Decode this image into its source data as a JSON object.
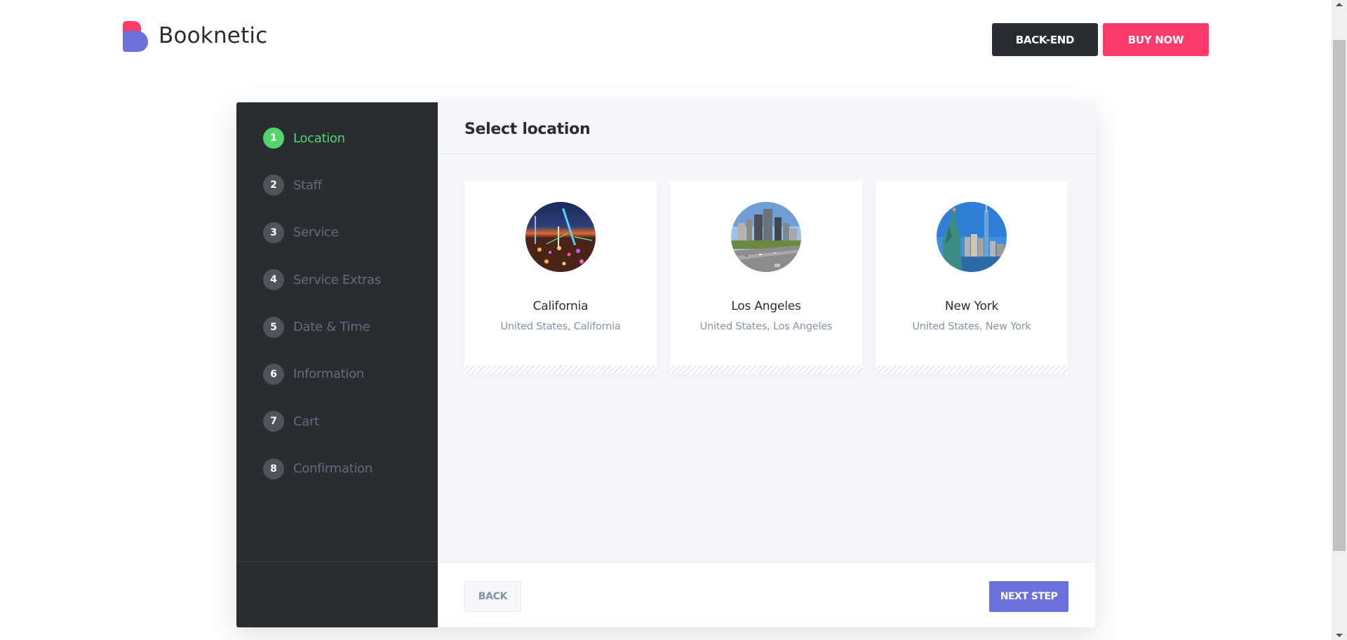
{
  "brand": {
    "name": "Booknetic"
  },
  "topbar": {
    "backend_label": "BACK-END",
    "buynow_label": "BUY NOW"
  },
  "colors": {
    "accent": "#6c70dc",
    "pink": "#fc3a6b",
    "active_step": "#53d56c",
    "sidebar_bg": "#292d32"
  },
  "steps": [
    {
      "num": "1",
      "label": "Location",
      "active": true
    },
    {
      "num": "2",
      "label": "Staff",
      "active": false
    },
    {
      "num": "3",
      "label": "Service",
      "active": false
    },
    {
      "num": "4",
      "label": "Service Extras",
      "active": false
    },
    {
      "num": "5",
      "label": "Date & Time",
      "active": false
    },
    {
      "num": "6",
      "label": "Information",
      "active": false
    },
    {
      "num": "7",
      "label": "Cart",
      "active": false
    },
    {
      "num": "8",
      "label": "Confirmation",
      "active": false
    }
  ],
  "main": {
    "title": "Select location",
    "locations": [
      {
        "name": "California",
        "address": "United States, California",
        "image": "california-night-fair-photo"
      },
      {
        "name": "Los Angeles",
        "address": "United States, Los Angeles",
        "image": "los-angeles-skyline-photo"
      },
      {
        "name": "New York",
        "address": "United States, New York",
        "image": "new-york-statue-of-liberty-photo"
      }
    ]
  },
  "footer": {
    "back_label": "BACK",
    "next_label": "NEXT STEP"
  }
}
